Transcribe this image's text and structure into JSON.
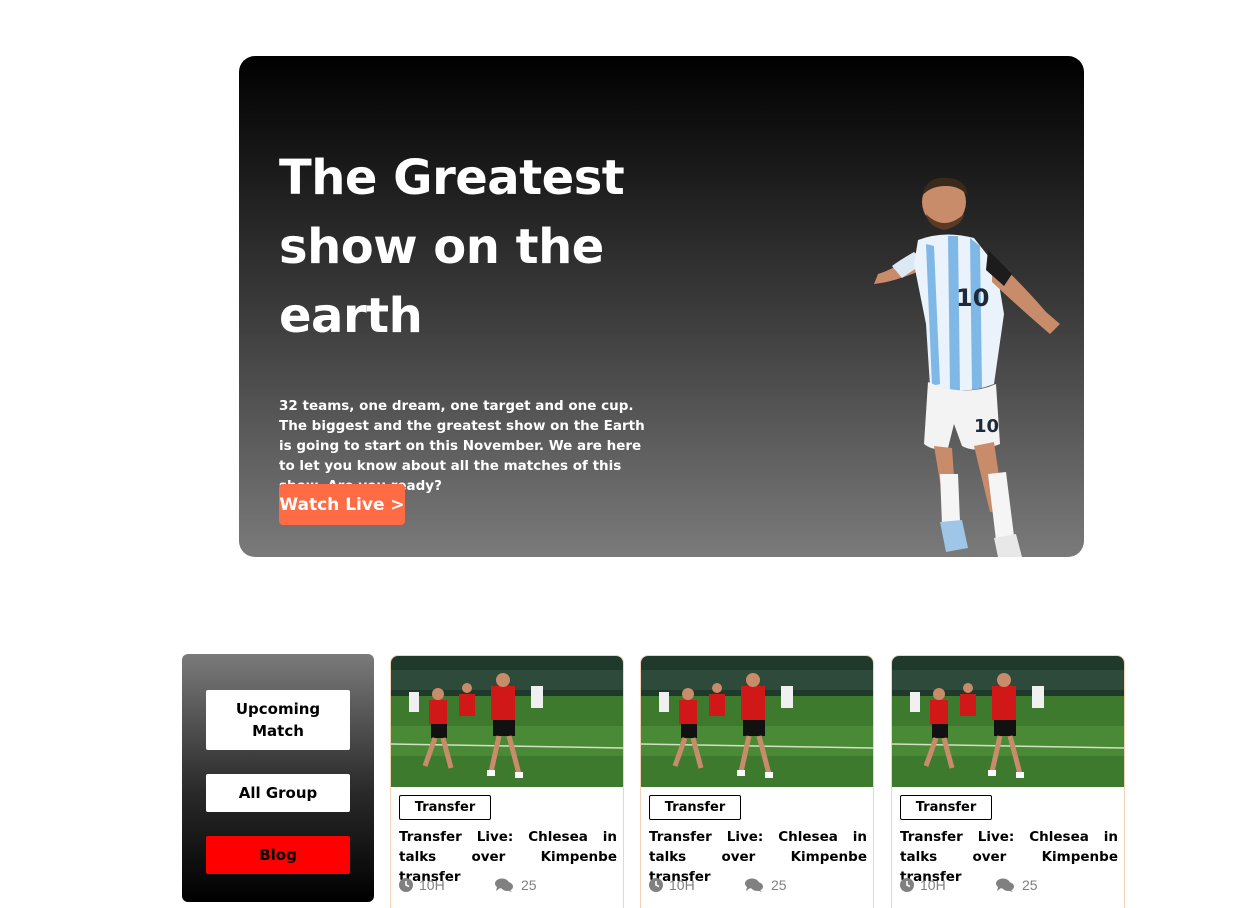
{
  "hero": {
    "title": "The Greatest show on the earth",
    "description": "32 teams, one dream, one target and one cup. The biggest and the greatest show on the Earth is going to start on this November. We are here to let you know about all the matches of this show. Are you ready?",
    "cta_label": "Watch Live >",
    "player_image_icon": "player-celebrating-image"
  },
  "side_menu": {
    "items": [
      {
        "label": "Upcoming Match"
      },
      {
        "label": "All Group"
      },
      {
        "label": "Blog"
      }
    ]
  },
  "cards": [
    {
      "tag": "Transfer",
      "title": "Transfer Live: Chlesea in talks over Kimpenbe transfer",
      "time": "10H",
      "comments": "25"
    },
    {
      "tag": "Transfer",
      "title": "Transfer Live: Chlesea in talks over Kimpenbe transfer",
      "time": "10H",
      "comments": "25"
    },
    {
      "tag": "Transfer",
      "title": "Transfer Live: Chlesea in talks over Kimpenbe transfer",
      "time": "10H",
      "comments": "25"
    }
  ],
  "colors": {
    "cta": "#ff6b45",
    "blog_button": "#ff0000",
    "card_border": "#f3d3b8",
    "meta_text": "#808080"
  },
  "icons": {
    "time": "clock-icon",
    "comments": "comments-icon"
  }
}
